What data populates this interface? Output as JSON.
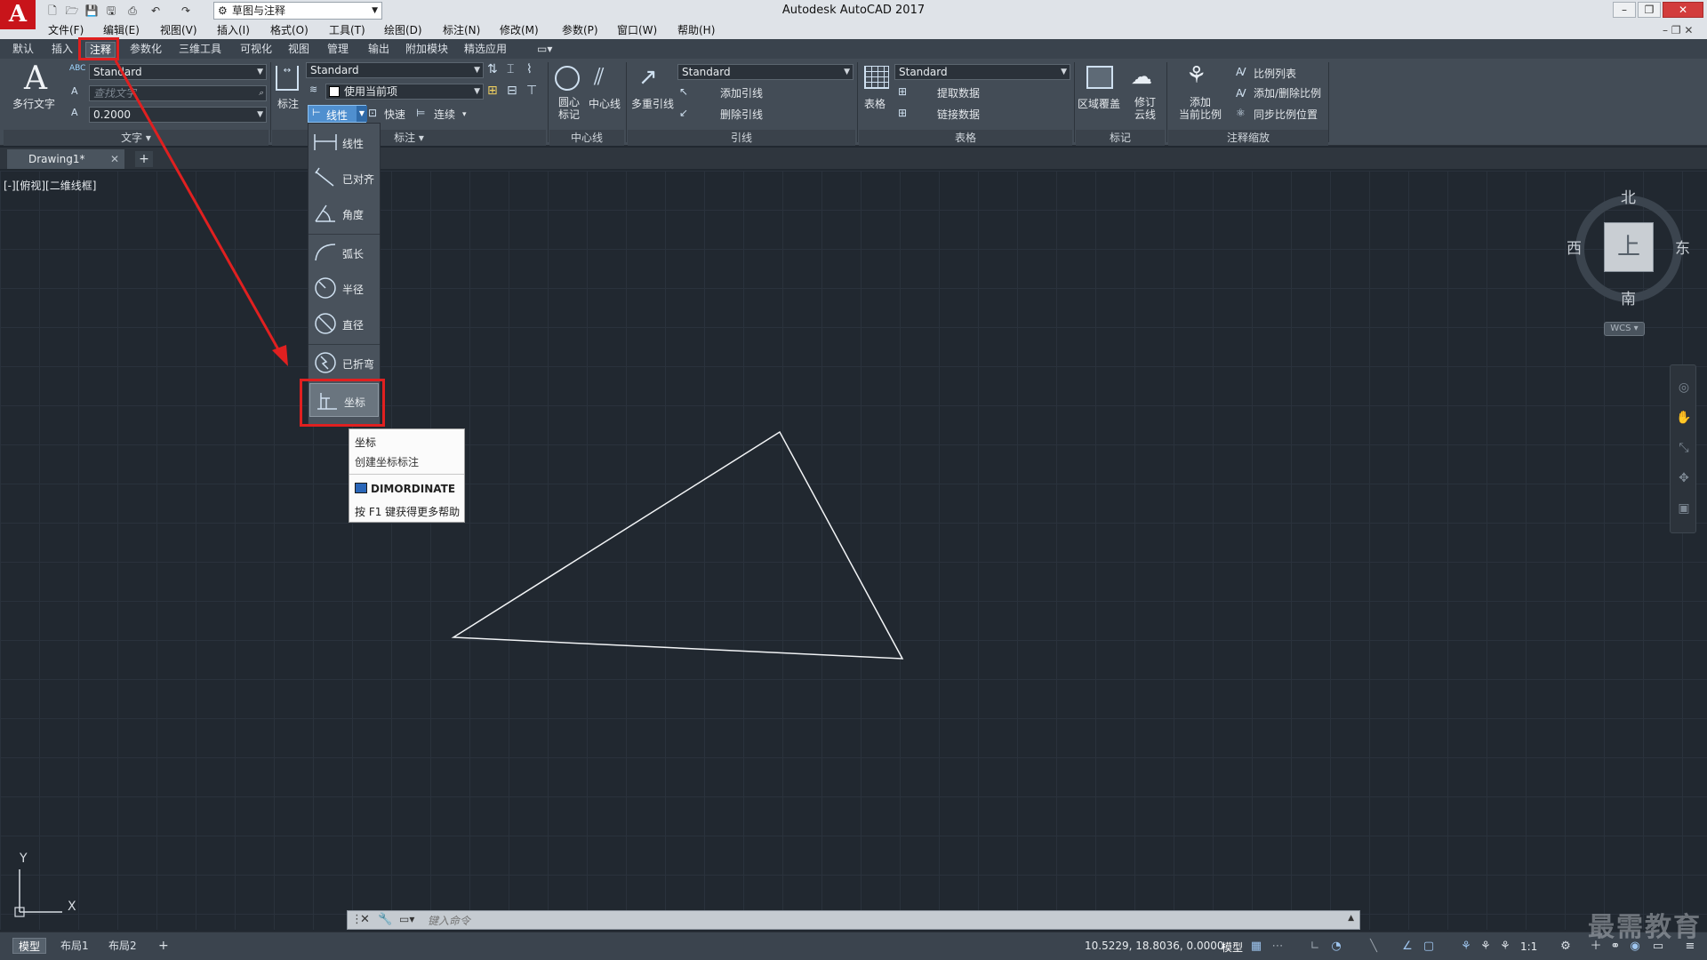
{
  "window": {
    "title": "Autodesk AutoCAD 2017",
    "workspace": "草图与注释"
  },
  "menubar": [
    "文件(F)",
    "编辑(E)",
    "视图(V)",
    "插入(I)",
    "格式(O)",
    "工具(T)",
    "绘图(D)",
    "标注(N)",
    "修改(M)",
    "参数(P)",
    "窗口(W)",
    "帮助(H)"
  ],
  "ribbon_tabs": [
    "默认",
    "插入",
    "注释",
    "参数化",
    "三维工具",
    "可视化",
    "视图",
    "管理",
    "输出",
    "附加模块",
    "精选应用"
  ],
  "active_ribbon_tab": "注释",
  "ribbon": {
    "text_panel": {
      "mtext_label": "多行文字",
      "text_style": "Standard",
      "find_placeholder": "查找文字",
      "text_height": "0.2000",
      "footer": "文字"
    },
    "dim_panel": {
      "dim_label": "标注",
      "dim_style": "Standard",
      "layer_value": "使用当前项",
      "linear_label": "线性",
      "quick_label": "快速",
      "continue_label": "连续",
      "footer": "标注"
    },
    "centerline_panel": {
      "center_mark_label": "圆心\n标记",
      "centerline_label": "中心线",
      "footer": "中心线"
    },
    "leader_panel": {
      "multileader_label": "多重引线",
      "leader_style": "Standard",
      "add_leader": "添加引线",
      "remove_leader": "删除引线",
      "footer": "引线"
    },
    "table_panel": {
      "table_label": "表格",
      "table_style": "Standard",
      "extract_data": "提取数据",
      "link_data": "链接数据",
      "footer": "表格"
    },
    "markup_panel": {
      "wipeout_label": "区域覆盖",
      "revcloud_label": "修订\n云线",
      "footer": "标记"
    },
    "scale_panel": {
      "add_scale_label": "添加\n当前比例",
      "scale_list": "比例列表",
      "add_delete_scale": "添加/删除比例",
      "sync_scale": "同步比例位置",
      "footer": "注释缩放"
    }
  },
  "dim_dropdown": {
    "items": [
      "线性",
      "已对齐",
      "角度",
      "弧长",
      "半径",
      "直径",
      "已折弯",
      "坐标"
    ],
    "highlighted": "坐标"
  },
  "tooltip": {
    "title": "坐标",
    "description": "创建坐标标注",
    "command": "DIMORDINATE",
    "help": "按 F1 键获得更多帮助"
  },
  "document_tabs": [
    "Drawing1*"
  ],
  "viewport_label": "[-][俯视][二维线框]",
  "viewcube": {
    "north": "北",
    "south": "南",
    "east": "东",
    "west": "西",
    "face": "上",
    "wcs": "WCS"
  },
  "ucs": {
    "x": "X",
    "y": "Y"
  },
  "command_line": {
    "placeholder": "键入命令"
  },
  "status_bar": {
    "layout_tabs": [
      "模型",
      "布局1",
      "布局2"
    ],
    "active_layout": "模型",
    "coordinates": "10.5229, 18.8036, 0.0000",
    "model_label": "模型",
    "scale": "1:1"
  },
  "watermark": "最需教育",
  "colors": {
    "canvas_bg": "#212830",
    "highlight": "#e02020",
    "brand": "#c8141a"
  }
}
